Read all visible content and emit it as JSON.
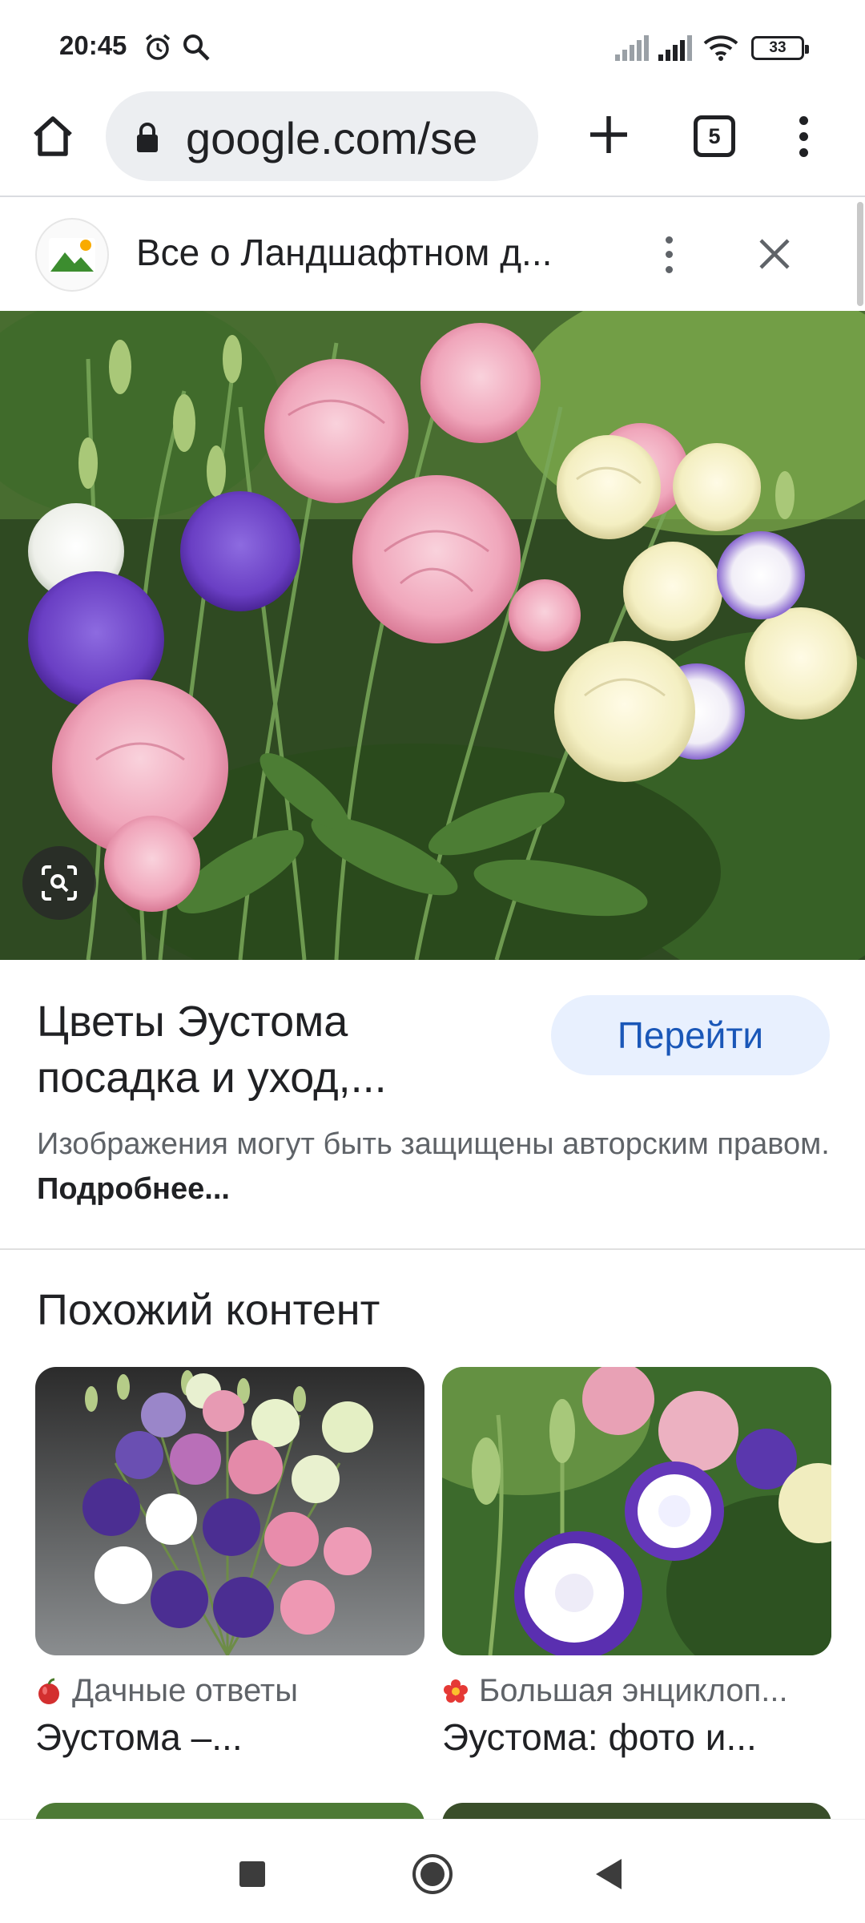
{
  "status_bar": {
    "time": "20:45",
    "battery": "33",
    "icons": [
      "alarm-icon",
      "search-icon",
      "signal-icon",
      "signal-icon",
      "wifi-icon",
      "battery-icon"
    ]
  },
  "toolbar": {
    "url": "google.com/se",
    "tab_count": "5",
    "icons": [
      "home-icon",
      "lock-icon",
      "plus-icon",
      "tabs-icon",
      "more-vert-icon"
    ]
  },
  "sheet": {
    "title": "Все о Ландшафтном д...",
    "icons": [
      "site-image-icon",
      "more-vert-icon",
      "close-icon"
    ]
  },
  "result": {
    "title": "Цветы Эустома посадка и уход,...",
    "go_button": "Перейти",
    "copyright": "Изображения могут быть защищены авторским правом.",
    "more_link": "Подробнее..."
  },
  "similar": {
    "heading": "Похожий контент",
    "cards": [
      {
        "source": "Дачные ответы",
        "title": "Эустома –...",
        "source_icon": "apple-icon"
      },
      {
        "source": "Большая энциклоп...",
        "title": "Эустома: фото и...",
        "source_icon": "flower-icon"
      }
    ]
  },
  "nav_bar": {
    "icons": [
      "recents-square-icon",
      "home-circle-icon",
      "back-triangle-icon"
    ]
  },
  "colors": {
    "accent": "#1a57b8",
    "button_bg": "#e8f0fe",
    "text_primary": "#202124",
    "text_secondary": "#5f6368"
  }
}
